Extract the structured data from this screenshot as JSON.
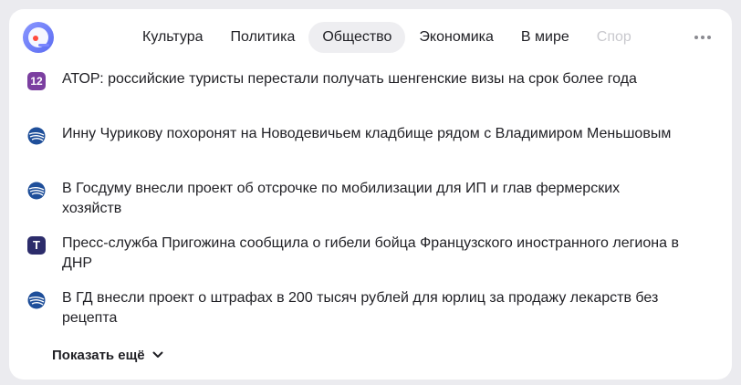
{
  "nav": {
    "tabs": [
      {
        "label": "Культура"
      },
      {
        "label": "Политика"
      },
      {
        "label": "Общество"
      },
      {
        "label": "Экономика"
      },
      {
        "label": "В мире"
      },
      {
        "label": "Спор"
      }
    ],
    "active_tab": "Общество"
  },
  "news": [
    {
      "source_icon": "ator-icon",
      "text": "АТОР: российские туристы перестали получать шенгенские визы на срок более года"
    },
    {
      "source_icon": "ria-icon",
      "text": "Инну Чурикову похоронят на Новодевичьем кладбище рядом с Владимиром Меньшовым"
    },
    {
      "source_icon": "ria-icon",
      "text": "В Госдуму внесли проект об отсрочке по мобилизации для ИП и глав фермерских хозяйств"
    },
    {
      "source_icon": "tass-icon",
      "text": "Пресс-служба Пригожина сообщила о гибели бойца Французского иностранного легиона в ДНР"
    },
    {
      "source_icon": "ria-icon",
      "text": "В ГД внесли проект о штрафах в 200 тысяч рублей для юрлиц за продажу лекарств без рецепта"
    }
  ],
  "icons": {
    "ator_glyph": "12",
    "tass_glyph": "T"
  },
  "show_more": {
    "label": "Показать ещё"
  },
  "colors": {
    "accent": "#5b6cf2",
    "active_tab_bg": "#eeeef1",
    "ria_blue": "#1f4f9a",
    "ator_purple": "#7b3fa0",
    "tass_navy": "#2c2c6b"
  }
}
